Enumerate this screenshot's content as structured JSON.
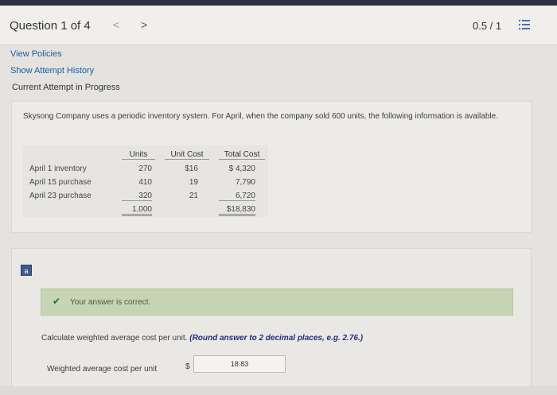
{
  "header": {
    "question_label": "Question 1 of 4",
    "prev_glyph": "<",
    "next_glyph": ">",
    "score": "0.5 / 1",
    "list_icon": "list-icon"
  },
  "links": {
    "view_policies": "View Policies",
    "show_attempt_history": "Show Attempt History"
  },
  "attempt_status": "Current Attempt in Progress",
  "problem": {
    "text": "Skysong Company uses a periodic inventory system. For April, when the company sold 600 units, the following information is available.",
    "table": {
      "headers": [
        "Units",
        "Unit Cost",
        "Total Cost"
      ],
      "rows": [
        {
          "label": "April 1 inventory",
          "units": "270",
          "unit_cost": "$16",
          "total_cost": "$ 4,320"
        },
        {
          "label": "April 15 purchase",
          "units": "410",
          "unit_cost": "19",
          "total_cost": "7,790"
        },
        {
          "label": "April 23 purchase",
          "units": "320",
          "unit_cost": "21",
          "total_cost": "6,720"
        }
      ],
      "total_units": "1,000",
      "total_cost": "$18,830"
    }
  },
  "part": {
    "label": "a",
    "feedback": "Your answer is correct.",
    "instruction": "Calculate weighted average cost per unit.",
    "instruction_note": "(Round answer to 2 decimal places, e.g. 2.76.)",
    "field_label": "Weighted average cost per unit",
    "currency": "$",
    "answer_value": "18.83"
  },
  "colors": {
    "link": "#1f5aa0",
    "correct_bg": "#c7d5b4",
    "check": "#2b6e2b",
    "note": "#2a2a7a",
    "part_badge": "#3e5a8a"
  }
}
